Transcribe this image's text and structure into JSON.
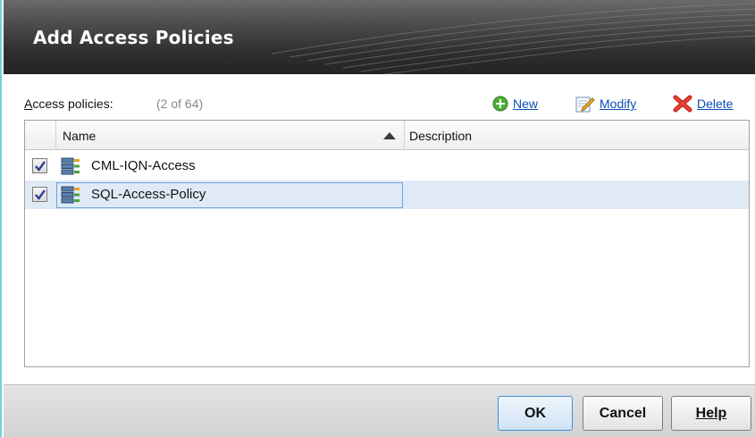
{
  "dialog": {
    "title": "Add Access Policies"
  },
  "policies": {
    "label_prefix": "A",
    "label_rest": "ccess policies:",
    "count": "(2 of 64)"
  },
  "actions": {
    "new": "New",
    "modify": "Modify",
    "delete": "Delete"
  },
  "grid": {
    "columns": {
      "name": "Name",
      "description": "Description"
    },
    "sort": "ascending",
    "rows": [
      {
        "checked": true,
        "name": "CML-IQN-Access",
        "description": ""
      },
      {
        "checked": true,
        "name": "SQL-Access-Policy",
        "description": ""
      }
    ]
  },
  "buttons": {
    "ok": "OK",
    "cancel": "Cancel",
    "help": "Help"
  },
  "colors": {
    "link": "#0b4db3",
    "selected_row": "#dfeaf6",
    "accent": "#6fd3e0"
  }
}
